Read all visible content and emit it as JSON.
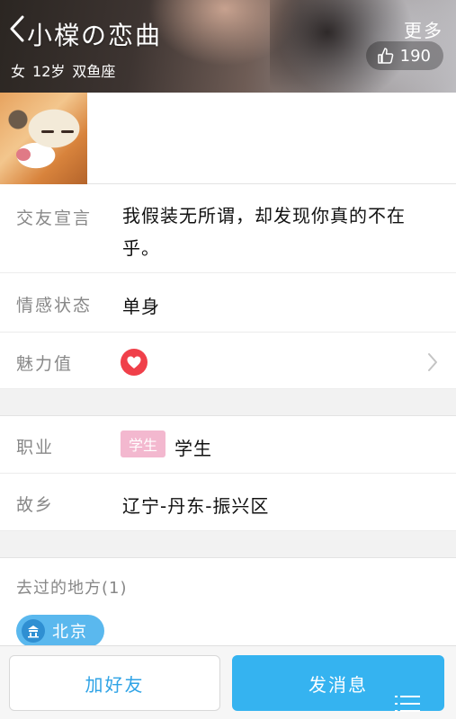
{
  "header": {
    "name": "小橖の恋曲",
    "more_label": "更多",
    "gender": "女",
    "age": "12岁",
    "zodiac": "双鱼座",
    "likes": "190"
  },
  "info": {
    "motto_label": "交友宣言",
    "motto_value": "我假装无所谓，却发现你真的不在乎。",
    "relationship_label": "情感状态",
    "relationship_value": "单身",
    "charm_label": "魅力值",
    "job_label": "职业",
    "job_tag": "学生",
    "job_value": "学生",
    "hometown_label": "故乡",
    "hometown_value": "辽宁-丹东-振兴区"
  },
  "places": {
    "title": "去过的地方(1)",
    "items": [
      "北京"
    ]
  },
  "actions": {
    "add_friend": "加好友",
    "send_message": "发消息"
  },
  "colors": {
    "accent": "#35b3f0",
    "heart": "#f0404a",
    "tag": "#f3b8cf"
  }
}
